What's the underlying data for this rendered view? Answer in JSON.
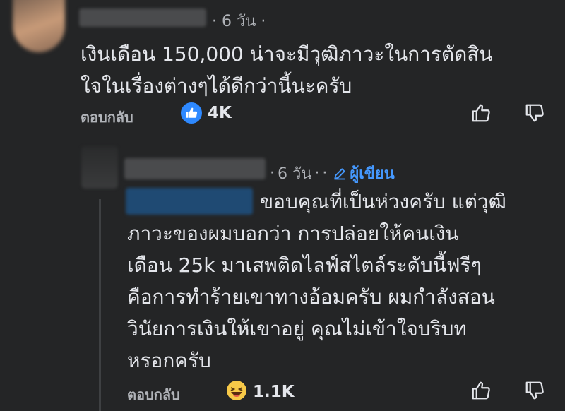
{
  "comment1": {
    "time": "6 วัน",
    "text_line1": "เงินเดือน 150,000 น่าจะมีวุฒิภาวะในการตัดสิน",
    "text_line2": "ใจในเรื่องต่างๆได้ดีกว่านี้นะครับ",
    "reply_label": "ตอบกลับ",
    "reaction_icon": "like-icon",
    "reaction_color": "#2e89ff",
    "reaction_count": "4K"
  },
  "reply": {
    "time": "6 วัน",
    "author_badge": "ผู้เขียน",
    "author_badge_color": "#4599ff",
    "text_lines": [
      "ขอบคุณที่เป็นห่วงครับ แต่วุฒิ",
      "ภาวะของผมบอกว่า การปล่อยให้คนเงิน",
      "เดือน 25k มาเสพติดไลฟ์สไตล์ระดับนี้ฟรีๆ",
      "คือการทำร้ายเขาทางอ้อมครับ ผมกำลังสอน",
      "วินัยการเงินให้เขาอยู่ คุณไม่เข้าใจบริบท",
      "หรอกครับ"
    ],
    "reply_label": "ตอบกลับ",
    "reaction_icon": "laughing-emoji-icon",
    "reaction_count": "1.1K"
  }
}
